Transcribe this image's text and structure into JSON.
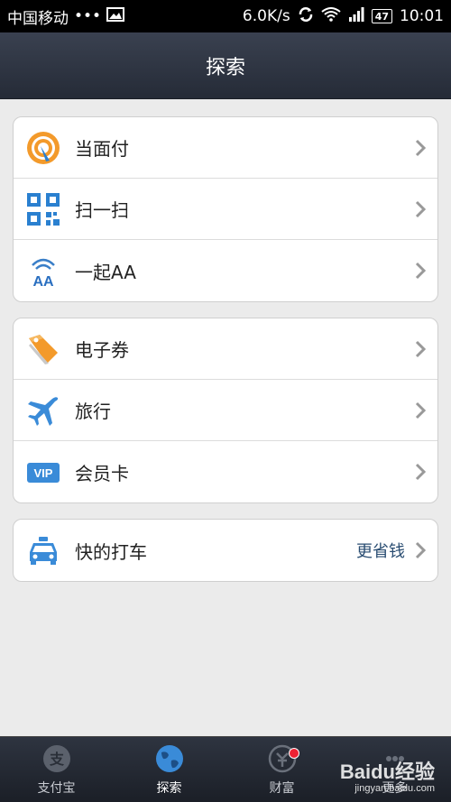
{
  "statusbar": {
    "carrier": "中国移动",
    "dots": "•••",
    "speed": "6.0K/s",
    "battery": "47",
    "time": "10:01"
  },
  "header": {
    "title": "探索"
  },
  "groups": [
    {
      "items": [
        {
          "label": "当面付",
          "icon": "face-pay-icon"
        },
        {
          "label": "扫一扫",
          "icon": "qr-scan-icon"
        },
        {
          "label": "一起AA",
          "icon": "aa-split-icon"
        }
      ]
    },
    {
      "items": [
        {
          "label": "电子券",
          "icon": "coupon-tag-icon"
        },
        {
          "label": "旅行",
          "icon": "airplane-icon"
        },
        {
          "label": "会员卡",
          "icon": "vip-card-icon"
        }
      ]
    },
    {
      "items": [
        {
          "label": "快的打车",
          "icon": "taxi-icon",
          "extra": "更省钱"
        }
      ]
    }
  ],
  "tabs": [
    {
      "label": "支付宝",
      "icon": "alipay-icon"
    },
    {
      "label": "探索",
      "icon": "globe-icon",
      "active": true
    },
    {
      "label": "财富",
      "icon": "wealth-icon",
      "badge": true
    },
    {
      "label": "更多",
      "icon": "more-icon"
    }
  ],
  "watermark": {
    "brand": "Baidu经验",
    "url": "jingyan.baidu.com"
  },
  "colors": {
    "header_bg": "#2b313d",
    "accent_blue": "#2a6fc0",
    "list_bg": "#ffffff",
    "page_bg": "#ebebeb"
  }
}
